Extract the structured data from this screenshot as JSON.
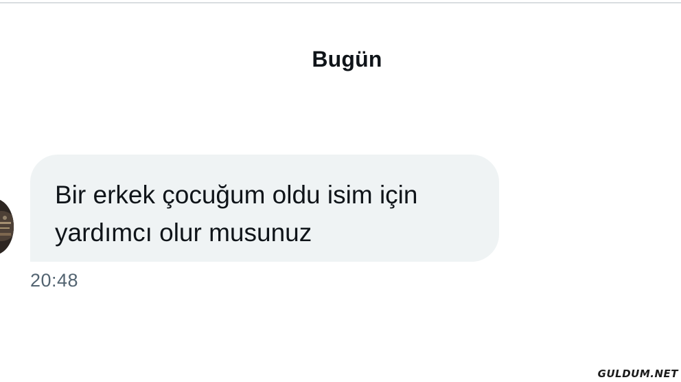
{
  "conversation": {
    "date_header": "Bugün",
    "messages": [
      {
        "text": "Bir erkek çocuğum oldu isim için\nyardımcı olur musunuz",
        "time": "20:48",
        "bubble_color": "#eff3f4"
      }
    ]
  },
  "watermark": {
    "text": "GULDUM.NET"
  },
  "icons": {
    "avatar": "profile-photo"
  }
}
